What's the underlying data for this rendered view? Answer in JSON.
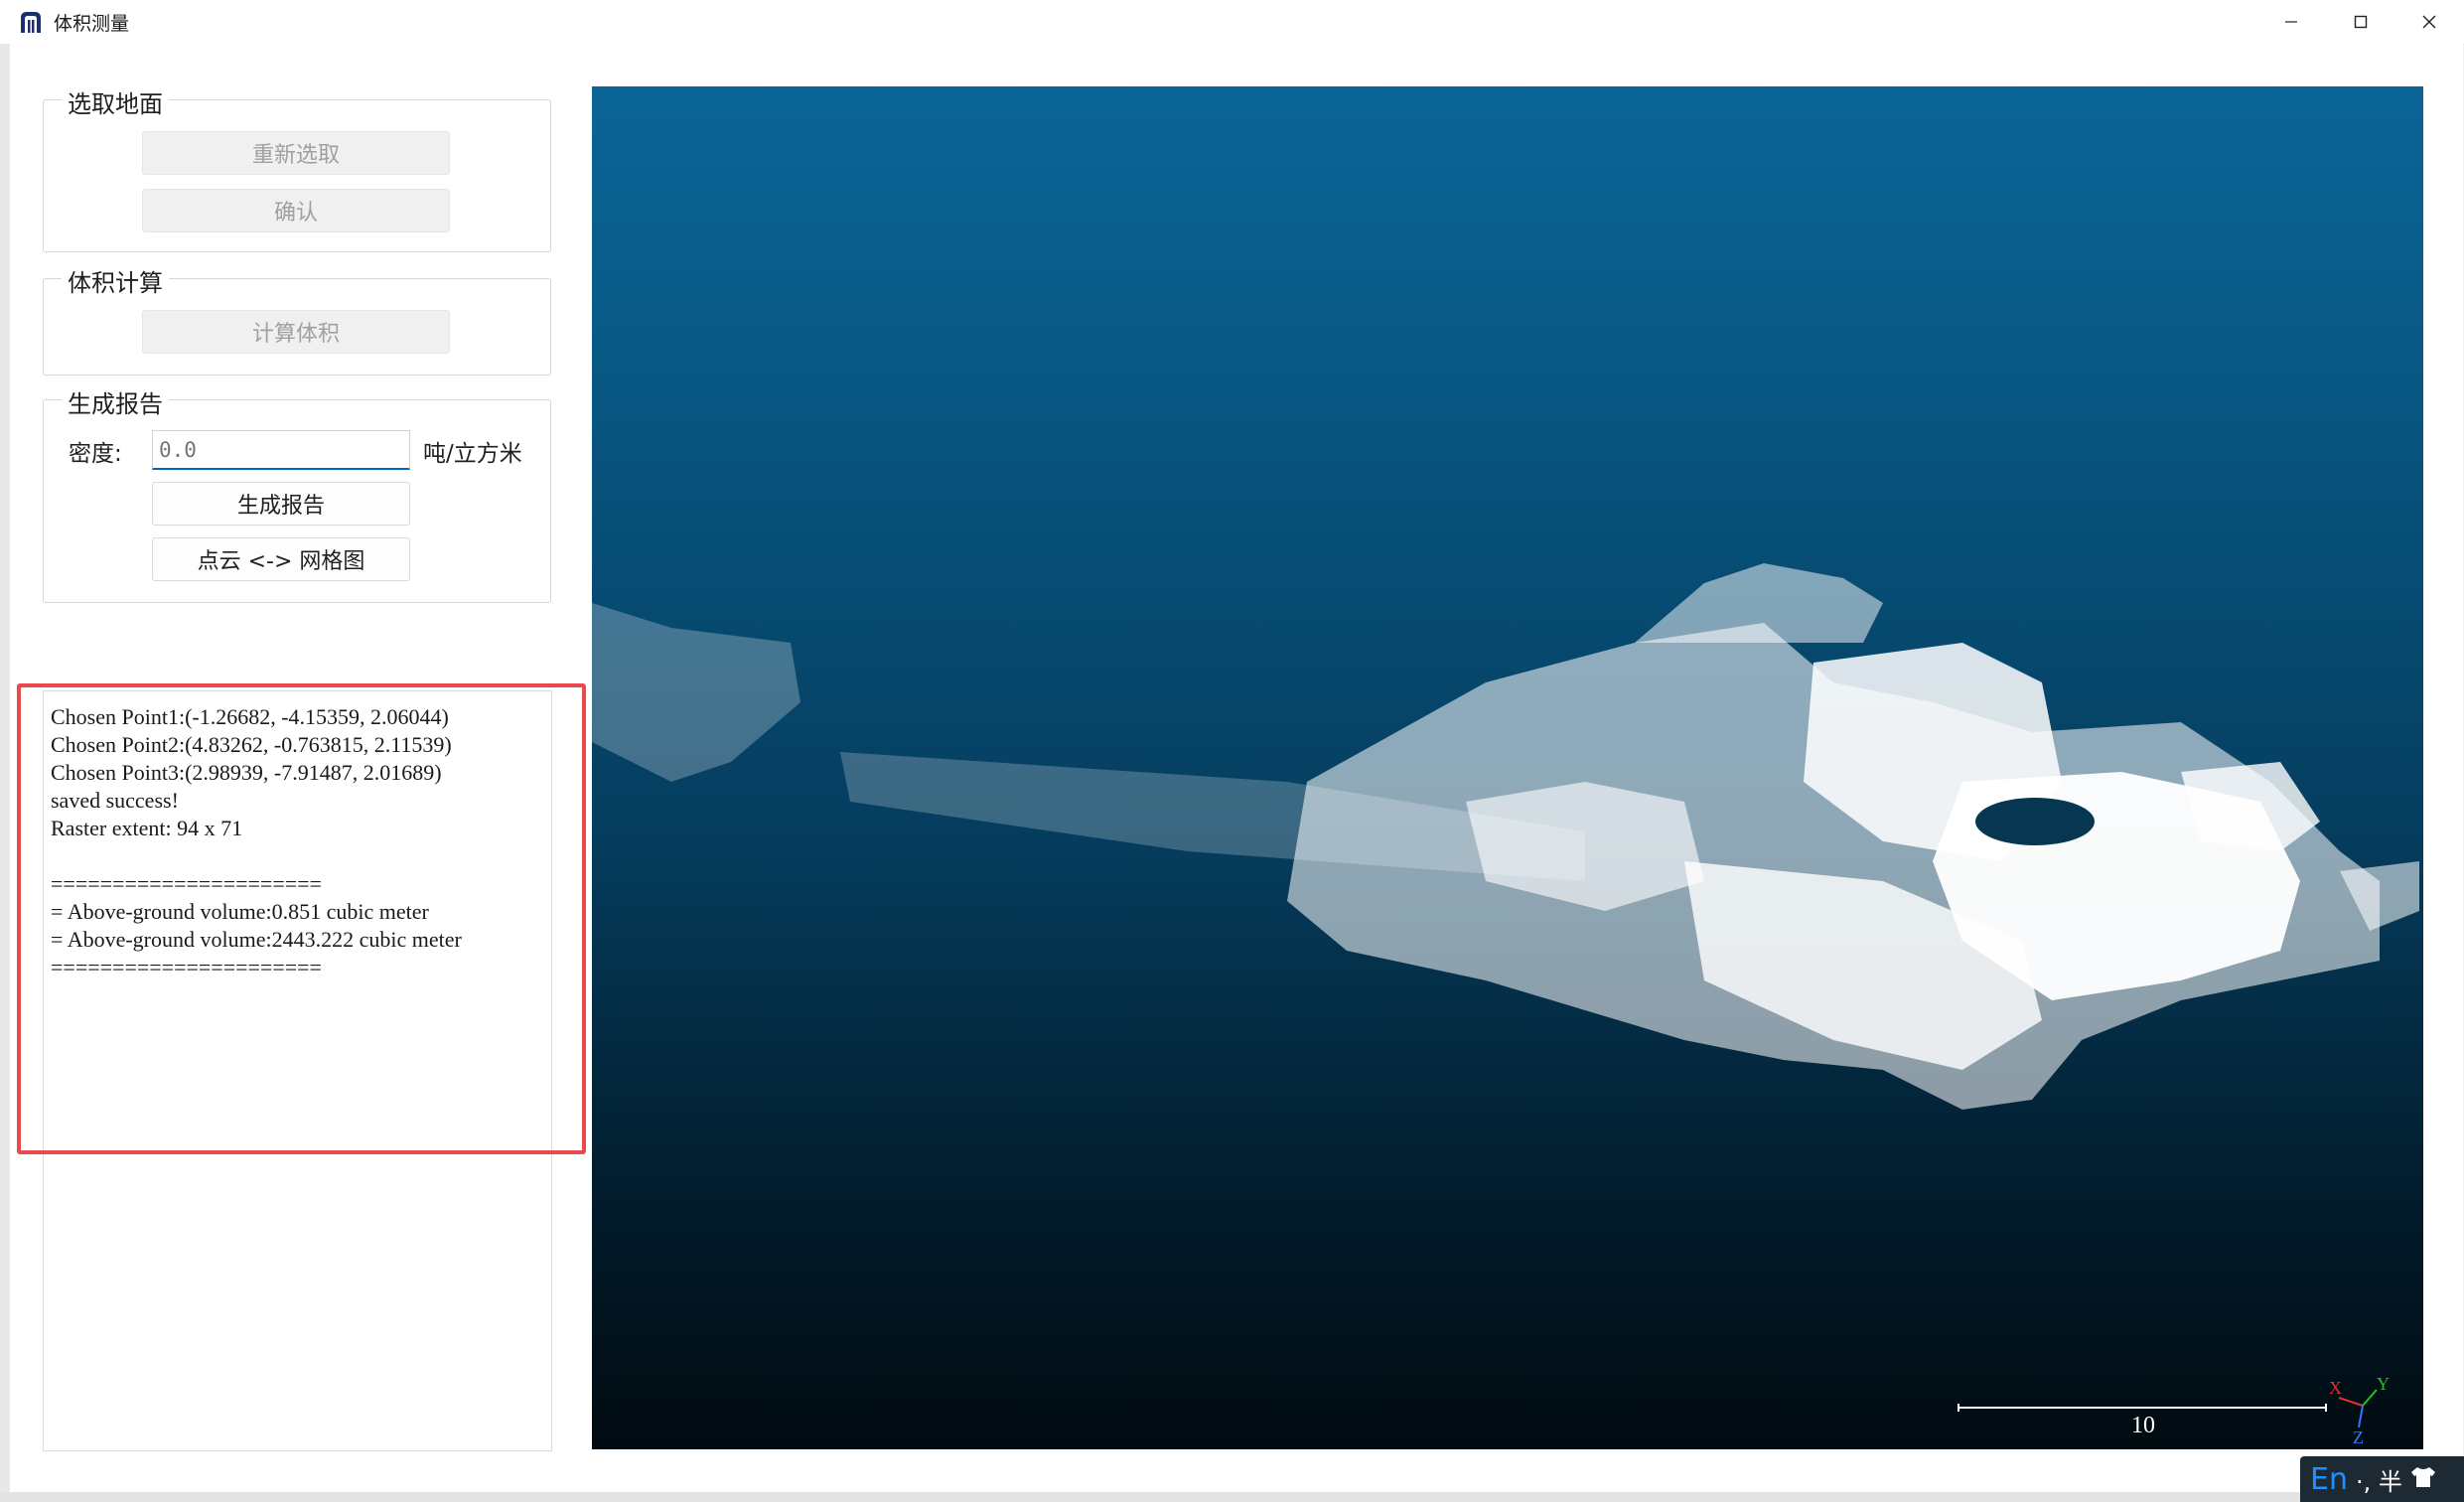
{
  "window": {
    "title": "体积测量"
  },
  "select_ground": {
    "title": "选取地面",
    "reselect_label": "重新选取",
    "confirm_label": "确认"
  },
  "volume_calc": {
    "title": "体积计算",
    "calc_label": "计算体积"
  },
  "report": {
    "title": "生成报告",
    "density_label": "密度:",
    "density_placeholder": "0.0",
    "density_unit": "吨/立方米",
    "generate_label": "生成报告",
    "toggle_view_label": "点云 <-> 网格图"
  },
  "console": {
    "text": "Chosen Point1:(-1.26682, -4.15359, 2.06044)\nChosen Point2:(4.83262, -0.763815, 2.11539)\nChosen Point3:(2.98939, -7.91487, 2.01689)\nsaved success!\nRaster extent: 94 x 71\n\n======================\n= Above-ground volume:0.851 cubic meter\n= Above-ground volume:2443.222 cubic meter\n======================"
  },
  "viewer": {
    "scale_value": "10",
    "axis_x": "X",
    "axis_y": "Y",
    "axis_z": "Z",
    "bg_top": "#0a6597",
    "bg_bottom": "#010a10"
  },
  "ime": {
    "lang": "En",
    "rest": "·, 半"
  },
  "colors": {
    "highlight": "#e84b4b",
    "accent": "#0067c0"
  }
}
